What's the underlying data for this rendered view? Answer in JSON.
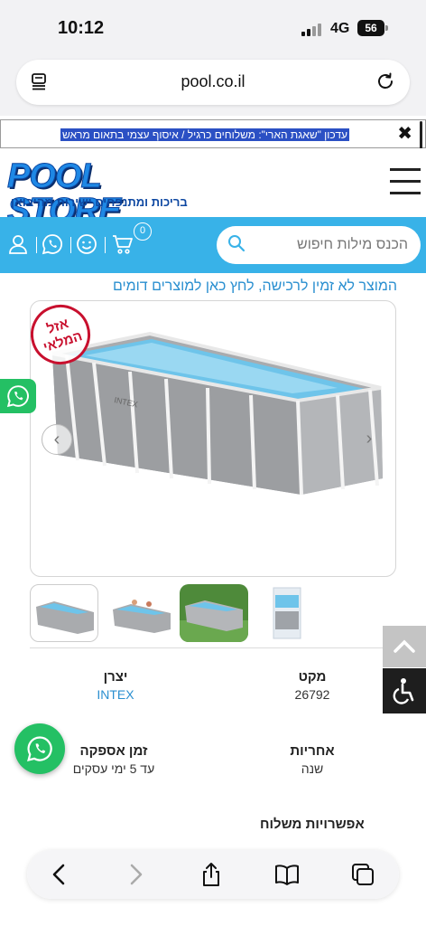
{
  "status_bar": {
    "time": "10:12",
    "network": "4G",
    "battery": "56"
  },
  "browser": {
    "url": "pool.co.il"
  },
  "announcement": {
    "text": "עדכון \"שאגת הארי\": משלוחים כרגיל / איסוף עצמי בתאום מראש",
    "close": "✖"
  },
  "header": {
    "logo_text": "POOL STORE",
    "logo_tagline": "בריכות ומתנפחים ישירות מהיבואן"
  },
  "toolbar": {
    "search_placeholder": "הכנס מילות חיפוש",
    "cart_count": "0"
  },
  "product": {
    "unavailable_notice": "המוצר לא זמין לרכישה, לחץ כאן למוצרים דומים",
    "stamp_line1": "אזל",
    "stamp_line2": "המלאי",
    "brand_on_pool": "INTEX",
    "nav_prev": "‹",
    "nav_next": "›",
    "specs": {
      "manufacturer_label": "יצרן",
      "manufacturer_value": "INTEX",
      "sku_label": "מקט",
      "sku_value": "26792",
      "supply_time_label": "זמן אספקה",
      "supply_time_value": "עד 5 ימי עסקים",
      "warranty_label": "אחריות",
      "warranty_value": "שנה"
    },
    "shipping_options_label": "אפשרויות משלוח"
  },
  "colors": {
    "brand_blue": "#38b2e8",
    "whatsapp_green": "#24c064",
    "link_blue": "#2a8fd0",
    "stamp_red": "#c8102e"
  },
  "icons": {
    "toolbar": [
      "user-icon",
      "whatsapp-icon",
      "smile-icon",
      "cart-icon"
    ],
    "bottom_bar": [
      "back-icon",
      "forward-icon",
      "share-icon",
      "bookmarks-icon",
      "tabs-icon"
    ]
  }
}
